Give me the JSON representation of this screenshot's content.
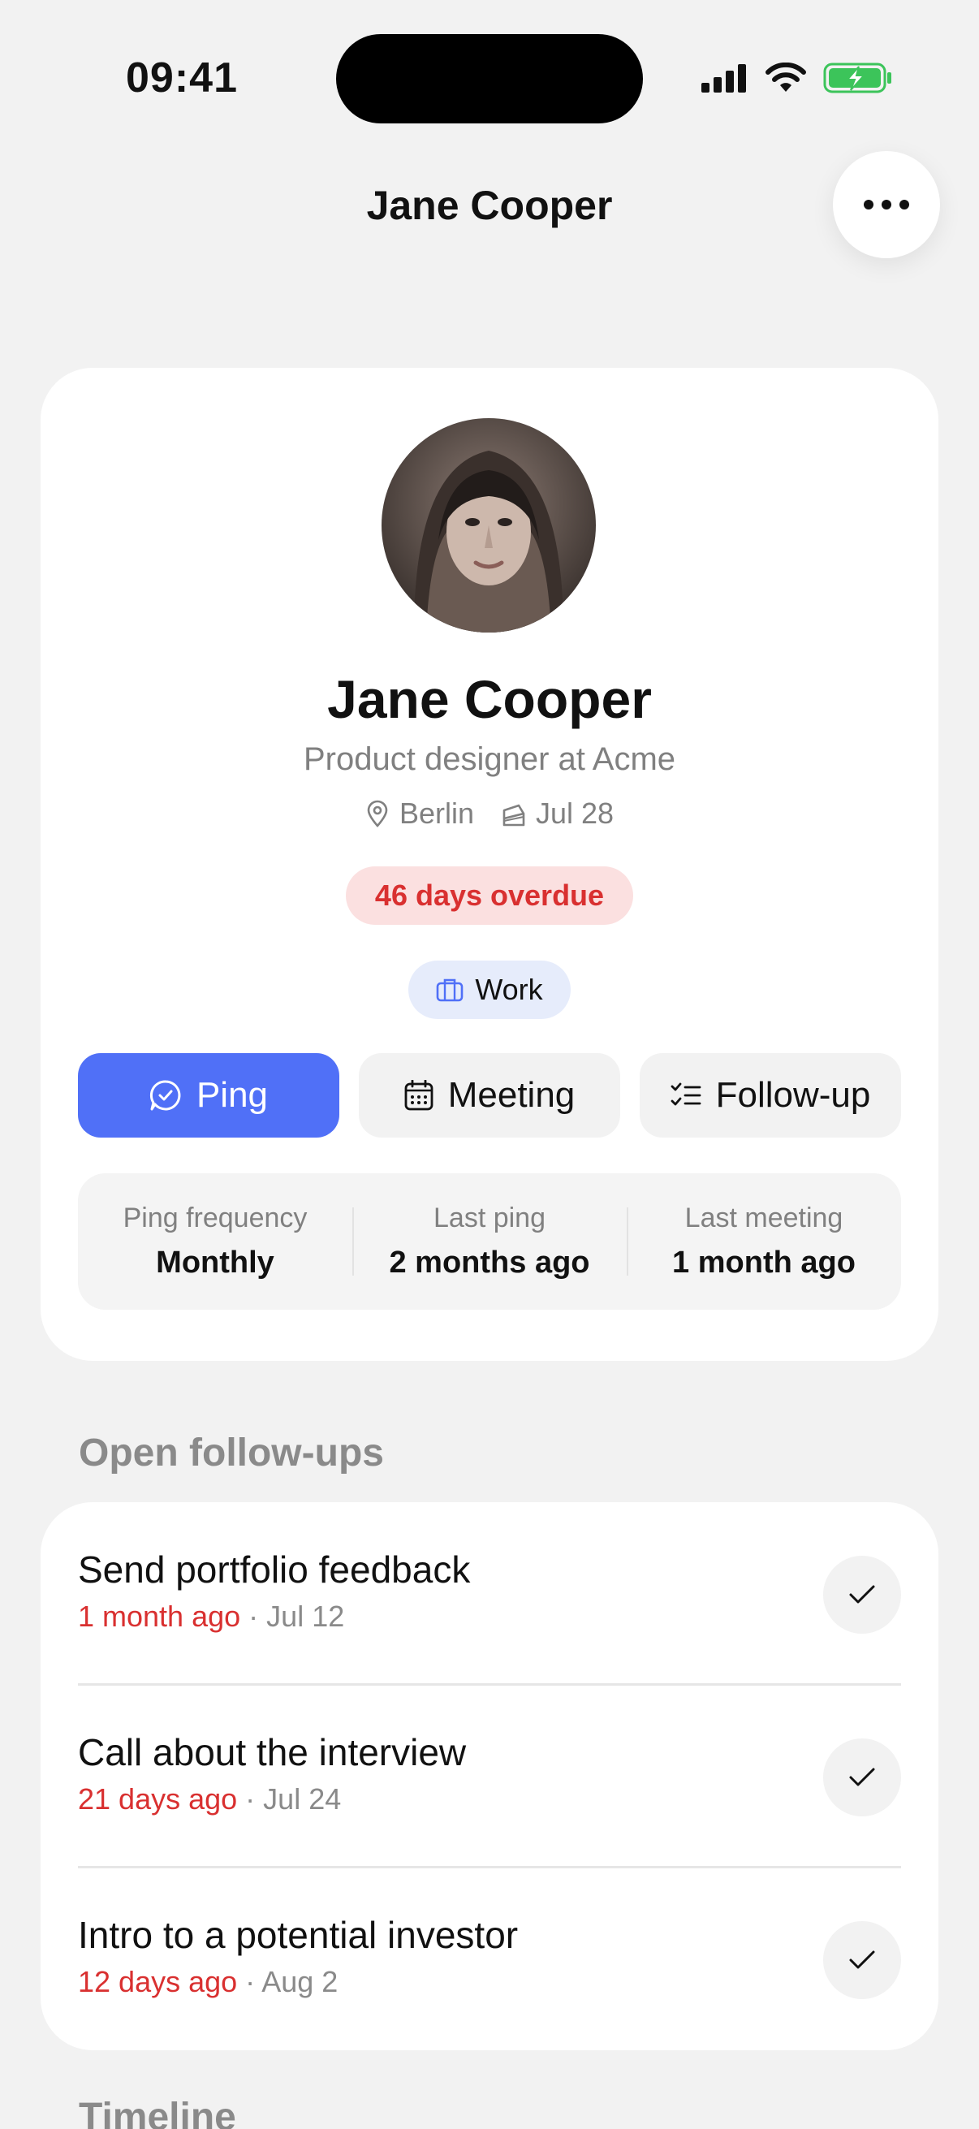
{
  "status_bar": {
    "time": "09:41"
  },
  "header": {
    "title": "Jane Cooper"
  },
  "profile": {
    "name": "Jane Cooper",
    "role": "Product designer at Acme",
    "location": "Berlin",
    "birthday": "Jul 28",
    "overdue": "46 days overdue",
    "tag": "Work"
  },
  "actions": {
    "ping": "Ping",
    "meeting": "Meeting",
    "followup": "Follow-up"
  },
  "stats": [
    {
      "label": "Ping frequency",
      "value": "Monthly"
    },
    {
      "label": "Last ping",
      "value": "2 months ago"
    },
    {
      "label": "Last meeting",
      "value": "1 month ago"
    }
  ],
  "followups": {
    "section_title": "Open follow-ups",
    "items": [
      {
        "title": "Send portfolio feedback",
        "ago": "1 month ago",
        "date": "Jul 12"
      },
      {
        "title": "Call about the interview",
        "ago": "21 days ago",
        "date": "Jul 24"
      },
      {
        "title": "Intro to a potential investor",
        "ago": "12 days ago",
        "date": "Aug 2"
      }
    ]
  },
  "timeline": {
    "section_title": "Timeline"
  },
  "colors": {
    "accent": "#5070f7",
    "overdue_text": "#d93030",
    "overdue_bg": "#fbe0e0",
    "tag_bg": "#e6ecfb",
    "background": "#f2f2f2"
  }
}
